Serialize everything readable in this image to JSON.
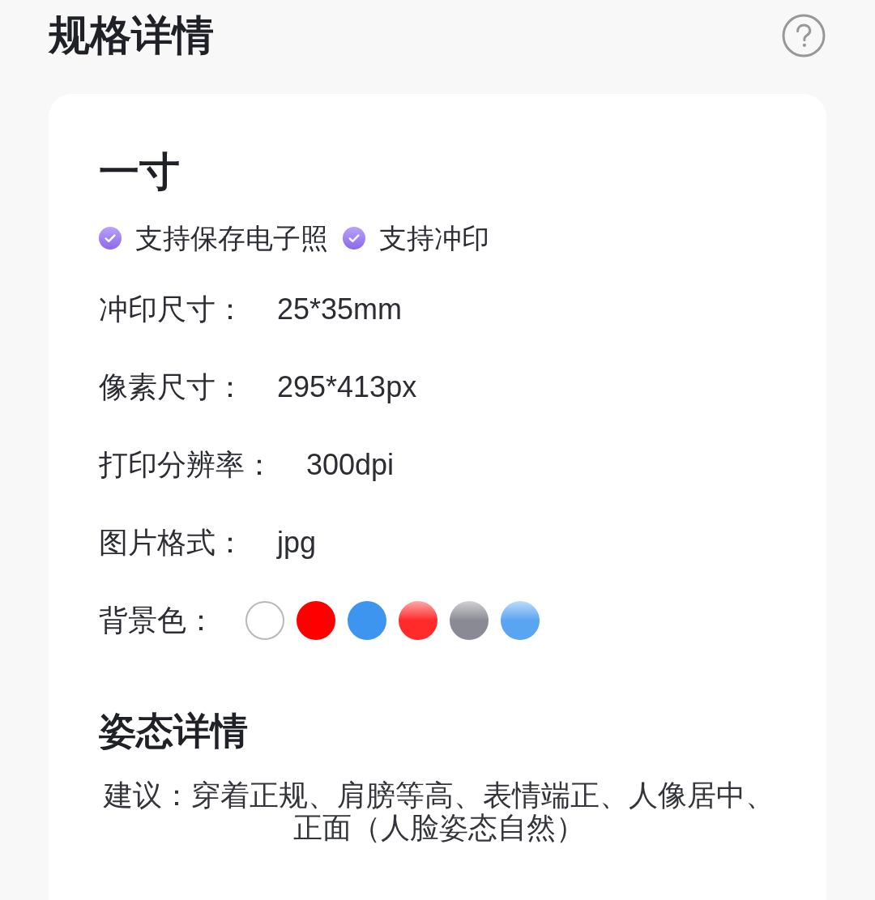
{
  "header": {
    "title": "规格详情"
  },
  "spec": {
    "name": "一寸",
    "features": [
      {
        "label": "支持保存电子照",
        "checked": true
      },
      {
        "label": "支持冲印",
        "checked": true
      }
    ],
    "rows": [
      {
        "label": "冲印尺寸：",
        "value": "25*35mm"
      },
      {
        "label": "像素尺寸：",
        "value": "295*413px"
      },
      {
        "label": "打印分辨率：",
        "value": "300dpi"
      },
      {
        "label": "图片格式：",
        "value": "jpg"
      }
    ],
    "background_colors": {
      "label": "背景色：",
      "swatches": [
        {
          "color": "#ffffff",
          "kind": "outline"
        },
        {
          "color": "#ff0000",
          "kind": "solid"
        },
        {
          "color": "#3d95ef",
          "kind": "solid"
        },
        {
          "color": "#ff2a2a",
          "kind": "gradient"
        },
        {
          "color": "#8a8a94",
          "kind": "gradient"
        },
        {
          "color": "#5aa5f2",
          "kind": "gradient"
        }
      ]
    }
  },
  "posture": {
    "title": "姿态详情",
    "advice": "建议：穿着正规、肩膀等高、表情端正、人像居中、正面（人脸姿态自然）"
  }
}
